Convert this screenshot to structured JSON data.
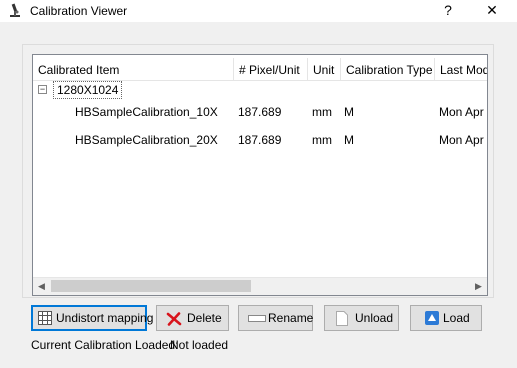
{
  "window": {
    "title": "Calibration Viewer",
    "help_label": "?",
    "close_label": "✕"
  },
  "tree": {
    "columns": [
      "Calibrated Item",
      "# Pixel/Unit",
      "Unit",
      "Calibration Type",
      "Last Mod"
    ],
    "root": {
      "expander": "−",
      "label": "1280X1024"
    },
    "rows": [
      {
        "item": "HBSampleCalibration_10X",
        "pixel_per_unit": "187.689",
        "unit": "mm",
        "type": "M",
        "last_mod": "Mon Apr"
      },
      {
        "item": "HBSampleCalibration_20X",
        "pixel_per_unit": "187.689",
        "unit": "mm",
        "type": "M",
        "last_mod": "Mon Apr"
      }
    ]
  },
  "scrollbar": {
    "left": "◀",
    "right": "▶"
  },
  "buttons": {
    "undistort": "Undistort mapping",
    "delete": "Delete",
    "rename": "Rename",
    "unload": "Unload",
    "load": "Load"
  },
  "status": {
    "label": "Current Calibration Loaded:",
    "value": "Not loaded"
  },
  "icons": {
    "app": "microscope-icon",
    "undistort": "grid-icon",
    "delete": "red-x-icon",
    "rename": "rename-field-icon",
    "unload": "blank-page-icon",
    "load": "blue-triangle-icon"
  },
  "colors": {
    "delete_x": "#d8141c",
    "load_blue": "#2c7ad6",
    "focus_border": "#0078d7"
  }
}
